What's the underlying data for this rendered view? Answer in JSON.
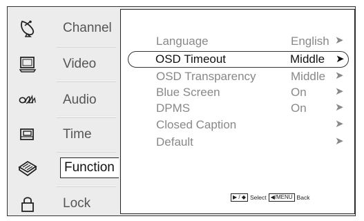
{
  "sidebar": {
    "items": [
      {
        "label": "Channel",
        "icon": "satellite-dish-icon"
      },
      {
        "label": "Video",
        "icon": "monitor-icon"
      },
      {
        "label": "Audio",
        "icon": "audio-icon"
      },
      {
        "label": "Time",
        "icon": "time-icon"
      },
      {
        "label": "Function",
        "icon": "function-icon",
        "active": true
      },
      {
        "label": "Lock",
        "icon": "lock-icon"
      }
    ]
  },
  "menu": {
    "items": [
      {
        "label": "Language",
        "value": "English",
        "arrow": "➤"
      },
      {
        "label": "OSD Timeout",
        "value": "Middle",
        "arrow": "➤",
        "selected": true
      },
      {
        "label": "OSD Transparency",
        "value": "Middle",
        "arrow": "➤"
      },
      {
        "label": "Blue Screen",
        "value": "On",
        "arrow": "➤"
      },
      {
        "label": "DPMS",
        "value": "On",
        "arrow": "➤"
      },
      {
        "label": "Closed Caption",
        "value": "",
        "arrow": "➤"
      },
      {
        "label": "Default",
        "value": "",
        "arrow": "➤"
      }
    ]
  },
  "footer": {
    "select_keys": "▶ / ◆",
    "select_label": "Select",
    "back_keys": "◀/MENU",
    "back_label": "Back"
  }
}
